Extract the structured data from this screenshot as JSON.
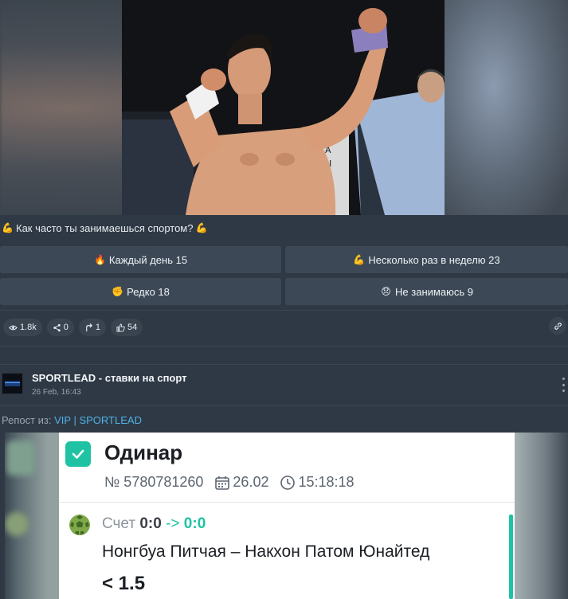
{
  "poll": {
    "question": "Как часто ты занимаешься спортом?",
    "options": [
      {
        "label": "Каждый день 15",
        "emoji": "🔥"
      },
      {
        "label": "Несколько раз в неделю 23",
        "emoji": "💪"
      },
      {
        "label": "Редко 18",
        "emoji": "✊"
      },
      {
        "label": "Не занимаюсь 9",
        "emoji": "😞"
      }
    ]
  },
  "stats": {
    "views": "1.8k",
    "shares": "0",
    "forwards": "1",
    "likes": "54"
  },
  "channel": {
    "name": "SPORTLEAD - ставки на спорт",
    "date": "26 Feb, 16:43",
    "avatar_text": "SPORTLEAD"
  },
  "repost": {
    "prefix": "Репост из:",
    "source": "VIP | SPORTLEAD"
  },
  "bet": {
    "title": "Одинар",
    "number": "№ 5780781260",
    "date": "26.02",
    "time": "15:18:18",
    "score_label": "Счет",
    "score_old": "0:0",
    "score_arrow": "->",
    "score_new": "0:0",
    "match": "Нонгбуа Питчая – Накхон Патом Юнайтед",
    "odd": "< 1.5"
  },
  "colors": {
    "background": "#2f3945",
    "poll_button": "#3c4856",
    "accent": "#1fc3a3",
    "link": "#4fb2e6"
  }
}
